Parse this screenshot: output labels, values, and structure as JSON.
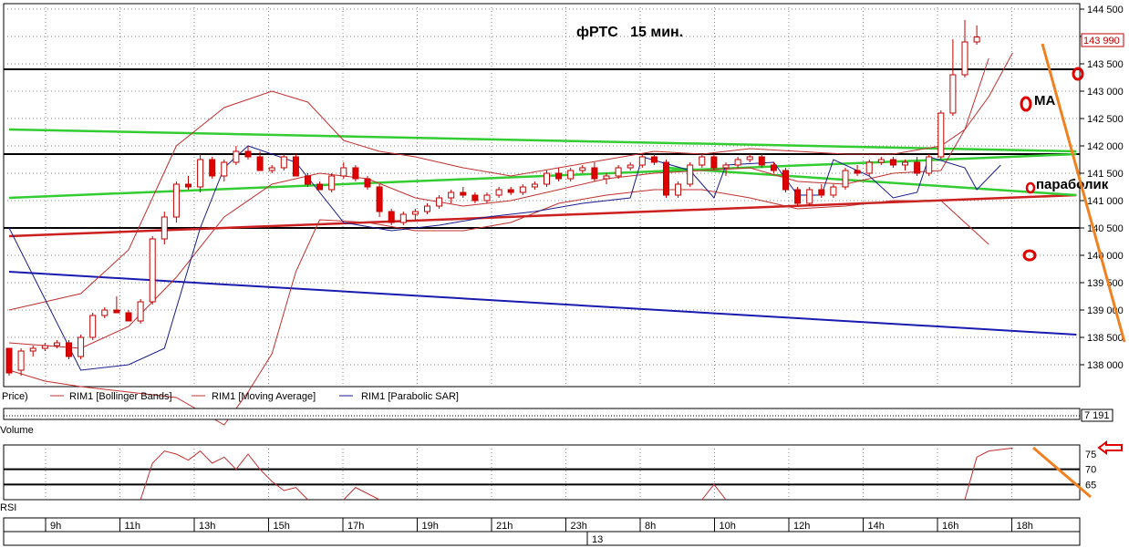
{
  "chart_data": [
    {
      "type": "candlestick",
      "title": "фРТС   15 мин.",
      "ylim": [
        137600,
        144600
      ],
      "y_ticks": [
        "144 500",
        "144 000",
        "143 500",
        "143 000",
        "142 500",
        "142 000",
        "141 500",
        "141 000",
        "140 500",
        "140 000",
        "139 500",
        "139 000",
        "138 500",
        "138 000"
      ],
      "last_price_label": "143 990",
      "horizontal_levels": [
        143400,
        141850,
        140500
      ],
      "legend": [
        "Price)",
        "RIM1 [Bollinger Bands]",
        "RIM1 [Moving Average]",
        "RIM1 [Parabolic SAR]"
      ],
      "annotations": [
        "МА",
        "параболик"
      ],
      "colors": {
        "bull": "#ffffff",
        "bear": "#e00000",
        "bollinger": "#c03030",
        "ma": "#c03030",
        "sar": "#1a1a8c",
        "trend_green": "#33cc33",
        "trend_red": "#cc2020",
        "trend_blue": "#1a1ab0",
        "arrow": "#f08020",
        "marker": "#e00000"
      },
      "candles": [
        [
          138300,
          138300,
          137800,
          137850
        ],
        [
          137900,
          138300,
          137800,
          138250
        ],
        [
          138250,
          138350,
          138150,
          138300
        ],
        [
          138300,
          138400,
          138250,
          138350
        ],
        [
          138350,
          138450,
          138300,
          138400
        ],
        [
          138400,
          138450,
          138100,
          138150
        ],
        [
          138150,
          138550,
          138100,
          138500
        ],
        [
          138500,
          138950,
          138450,
          138900
        ],
        [
          138900,
          139050,
          138850,
          139000
        ],
        [
          139000,
          139250,
          138950,
          138950
        ],
        [
          138950,
          139000,
          138800,
          138800
        ],
        [
          138800,
          139200,
          138750,
          139150
        ],
        [
          139150,
          140350,
          139100,
          140300
        ],
        [
          140300,
          140800,
          140200,
          140700
        ],
        [
          140700,
          141350,
          140600,
          141300
        ],
        [
          141300,
          141450,
          141200,
          141250
        ],
        [
          141250,
          141850,
          141150,
          141750
        ],
        [
          141750,
          141800,
          141400,
          141450
        ],
        [
          141450,
          141750,
          141350,
          141700
        ],
        [
          141700,
          142000,
          141650,
          141900
        ],
        [
          141900,
          142000,
          141750,
          141800
        ],
        [
          141800,
          141900,
          141550,
          141550
        ],
        [
          141550,
          141650,
          141500,
          141600
        ],
        [
          141600,
          141850,
          141550,
          141800
        ],
        [
          141800,
          141850,
          141450,
          141450
        ],
        [
          141450,
          141500,
          141250,
          141300
        ],
        [
          141300,
          141350,
          141200,
          141200
        ],
        [
          141200,
          141500,
          141150,
          141450
        ],
        [
          141450,
          141700,
          141400,
          141600
        ],
        [
          141600,
          141650,
          141350,
          141400
        ],
        [
          141400,
          141450,
          141200,
          141250
        ],
        [
          141250,
          141300,
          140700,
          140800
        ],
        [
          140800,
          140850,
          140550,
          140600
        ],
        [
          140600,
          140800,
          140550,
          140750
        ],
        [
          140750,
          140850,
          140650,
          140800
        ],
        [
          140800,
          140950,
          140750,
          140900
        ],
        [
          140900,
          141100,
          140850,
          141050
        ],
        [
          141050,
          141200,
          140950,
          141150
        ],
        [
          141150,
          141250,
          141050,
          141100
        ],
        [
          141100,
          141150,
          140950,
          141000
        ],
        [
          141000,
          141150,
          140950,
          141100
        ],
        [
          141100,
          141250,
          141050,
          141200
        ],
        [
          141200,
          141250,
          141100,
          141150
        ],
        [
          141150,
          141300,
          141100,
          141250
        ],
        [
          141250,
          141350,
          141200,
          141300
        ],
        [
          141300,
          141550,
          141250,
          141500
        ],
        [
          141500,
          141600,
          141350,
          141400
        ],
        [
          141400,
          141600,
          141350,
          141550
        ],
        [
          141550,
          141650,
          141500,
          141600
        ],
        [
          141600,
          141700,
          141350,
          141400
        ],
        [
          141400,
          141500,
          141300,
          141450
        ],
        [
          141450,
          141650,
          141400,
          141600
        ],
        [
          141600,
          141700,
          141550,
          141650
        ],
        [
          141650,
          141850,
          141600,
          141800
        ],
        [
          141800,
          141850,
          141650,
          141700
        ],
        [
          141700,
          141750,
          141050,
          141100
        ],
        [
          141100,
          141350,
          141050,
          141300
        ],
        [
          141300,
          141700,
          141250,
          141650
        ],
        [
          141650,
          141850,
          141600,
          141800
        ],
        [
          141800,
          141850,
          141550,
          141600
        ],
        [
          141600,
          141700,
          141450,
          141650
        ],
        [
          141650,
          141800,
          141600,
          141750
        ],
        [
          141750,
          141850,
          141700,
          141800
        ],
        [
          141800,
          141850,
          141600,
          141650
        ],
        [
          141650,
          141700,
          141500,
          141550
        ],
        [
          141550,
          141600,
          141150,
          141200
        ],
        [
          141200,
          141250,
          140900,
          140950
        ],
        [
          140950,
          141250,
          140900,
          141200
        ],
        [
          141200,
          141300,
          141050,
          141100
        ],
        [
          141100,
          141300,
          141050,
          141250
        ],
        [
          141250,
          141600,
          141200,
          141550
        ],
        [
          141550,
          141650,
          141450,
          141500
        ],
        [
          141500,
          141750,
          141450,
          141700
        ],
        [
          141700,
          141800,
          141650,
          141750
        ],
        [
          141750,
          141800,
          141600,
          141650
        ],
        [
          141650,
          141750,
          141550,
          141700
        ],
        [
          141700,
          141800,
          141450,
          141500
        ],
        [
          141500,
          141850,
          141450,
          141800
        ],
        [
          141800,
          142650,
          141750,
          142600
        ],
        [
          142600,
          143950,
          142550,
          143300
        ],
        [
          143300,
          144300,
          143250,
          143900
        ],
        [
          143900,
          144200,
          143850,
          143990
        ]
      ],
      "moving_average": [
        [
          0,
          138400
        ],
        [
          6,
          138300
        ],
        [
          10,
          138700
        ],
        [
          14,
          139600
        ],
        [
          18,
          140700
        ],
        [
          22,
          141300
        ],
        [
          26,
          141500
        ],
        [
          30,
          141400
        ],
        [
          34,
          141050
        ],
        [
          38,
          140900
        ],
        [
          42,
          141000
        ],
        [
          46,
          141200
        ],
        [
          50,
          141400
        ],
        [
          54,
          141500
        ],
        [
          58,
          141550
        ],
        [
          62,
          141600
        ],
        [
          66,
          141350
        ],
        [
          70,
          141300
        ],
        [
          74,
          141500
        ],
        [
          78,
          141550
        ],
        [
          80,
          142300
        ],
        [
          82,
          142900
        ],
        [
          84,
          143700
        ]
      ],
      "bollinger_upper": [
        [
          0,
          139000
        ],
        [
          6,
          139300
        ],
        [
          10,
          140100
        ],
        [
          14,
          142000
        ],
        [
          18,
          142700
        ],
        [
          22,
          143000
        ],
        [
          25,
          142800
        ],
        [
          28,
          142100
        ],
        [
          31,
          141900
        ],
        [
          34,
          141800
        ],
        [
          38,
          141600
        ],
        [
          42,
          141450
        ],
        [
          46,
          141600
        ],
        [
          50,
          141750
        ],
        [
          54,
          141900
        ],
        [
          58,
          141850
        ],
        [
          62,
          141950
        ],
        [
          66,
          141900
        ],
        [
          70,
          141850
        ],
        [
          74,
          141850
        ],
        [
          78,
          142000
        ],
        [
          80,
          142300
        ],
        [
          82,
          143600
        ]
      ],
      "bollinger_lower": [
        [
          0,
          137900
        ],
        [
          3,
          137700
        ],
        [
          6,
          137600
        ],
        [
          10,
          137500
        ],
        [
          14,
          137400
        ],
        [
          18,
          136900
        ],
        [
          20,
          137500
        ],
        [
          22,
          138200
        ],
        [
          24,
          139700
        ],
        [
          26,
          140650
        ],
        [
          30,
          140600
        ],
        [
          34,
          140450
        ],
        [
          38,
          140450
        ],
        [
          42,
          140600
        ],
        [
          46,
          140950
        ],
        [
          50,
          141100
        ],
        [
          54,
          141200
        ],
        [
          58,
          141200
        ],
        [
          62,
          141050
        ],
        [
          66,
          140850
        ],
        [
          70,
          140900
        ],
        [
          74,
          141000
        ],
        [
          78,
          141000
        ],
        [
          80,
          140600
        ],
        [
          82,
          140200
        ]
      ],
      "parabolic_sar": [
        [
          0,
          140500
        ],
        [
          6,
          137900
        ],
        [
          10,
          138000
        ],
        [
          13,
          138300
        ],
        [
          16,
          140500
        ],
        [
          18,
          141600
        ],
        [
          20,
          142000
        ],
        [
          24,
          141700
        ],
        [
          28,
          140600
        ],
        [
          32,
          140450
        ],
        [
          36,
          140550
        ],
        [
          40,
          140700
        ],
        [
          44,
          140800
        ],
        [
          48,
          140950
        ],
        [
          52,
          141050
        ],
        [
          53,
          141800
        ],
        [
          57,
          141550
        ],
        [
          59,
          141050
        ],
        [
          60,
          141650
        ],
        [
          64,
          141700
        ],
        [
          66,
          141100
        ],
        [
          68,
          141100
        ],
        [
          69,
          141750
        ],
        [
          72,
          141450
        ],
        [
          74,
          141050
        ],
        [
          76,
          141150
        ],
        [
          77,
          141800
        ],
        [
          80,
          141600
        ],
        [
          81,
          141200
        ],
        [
          83,
          141650
        ]
      ],
      "trend_green_1": [
        [
          0,
          142300
        ],
        [
          84,
          141900
        ]
      ],
      "trend_green_2": [
        [
          0,
          141050
        ],
        [
          84,
          141850
        ]
      ],
      "trend_green_3": [
        [
          55,
          141600
        ],
        [
          84,
          141100
        ]
      ],
      "trend_red": [
        [
          0,
          140350
        ],
        [
          84,
          141100
        ]
      ],
      "trend_blue": [
        [
          0,
          139700
        ],
        [
          84,
          138550
        ]
      ]
    },
    {
      "type": "line",
      "title": "RSI",
      "ylim": [
        60,
        78
      ],
      "y_ticks": [
        "75",
        "70",
        "65"
      ],
      "levels": [
        70,
        65
      ],
      "values": [
        [
          11,
          60
        ],
        [
          12,
          72
        ],
        [
          13,
          76
        ],
        [
          14,
          75
        ],
        [
          15,
          73
        ],
        [
          16,
          76
        ],
        [
          17,
          72
        ],
        [
          18,
          74
        ],
        [
          19,
          70
        ],
        [
          20,
          75
        ],
        [
          21,
          70
        ],
        [
          22,
          66
        ],
        [
          23,
          63
        ],
        [
          24,
          64
        ],
        [
          25,
          60
        ],
        [
          28,
          60
        ],
        [
          29,
          64
        ],
        [
          31,
          60
        ],
        [
          58,
          60
        ],
        [
          59,
          65
        ],
        [
          60,
          60
        ],
        [
          80,
          60
        ],
        [
          81,
          74
        ],
        [
          82,
          76
        ],
        [
          84,
          77
        ]
      ]
    }
  ],
  "volume_panel": {
    "title": "Volume",
    "value": "7 191"
  },
  "time_axis": {
    "labels": [
      "9h",
      "11h",
      "13h",
      "15h",
      "17h",
      "19h",
      "21h",
      "23h",
      "8h",
      "10h",
      "12h",
      "14h",
      "16h",
      "18h"
    ],
    "date_label": "13"
  }
}
